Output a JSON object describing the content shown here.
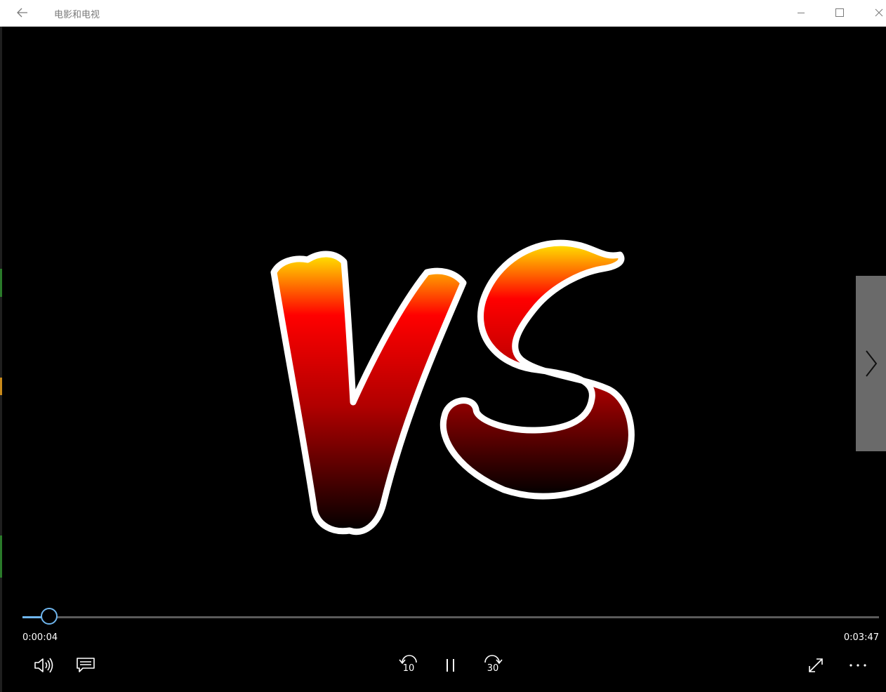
{
  "window": {
    "title": "电影和电视"
  },
  "player": {
    "current_time": "0:00:04",
    "total_time": "0:03:47",
    "progress_fraction": 0.018,
    "skip_back_seconds": "10",
    "skip_forward_seconds": "30",
    "accent_color": "#6fb6ee"
  },
  "video_frame": {
    "text": "VS",
    "gradient_top": "#ffe600",
    "gradient_mid": "#ff0000",
    "gradient_bottom": "#000000"
  },
  "icons": {
    "back": "back-arrow-icon",
    "minimize": "minimize-icon",
    "maximize": "maximize-icon",
    "close": "close-icon",
    "next": "chevron-right-icon",
    "volume": "volume-icon",
    "subtitles": "subtitles-icon",
    "skip_back": "skip-back-icon",
    "pause": "pause-icon",
    "skip_forward": "skip-forward-icon",
    "fullscreen": "fullscreen-icon",
    "more": "more-options-icon"
  }
}
